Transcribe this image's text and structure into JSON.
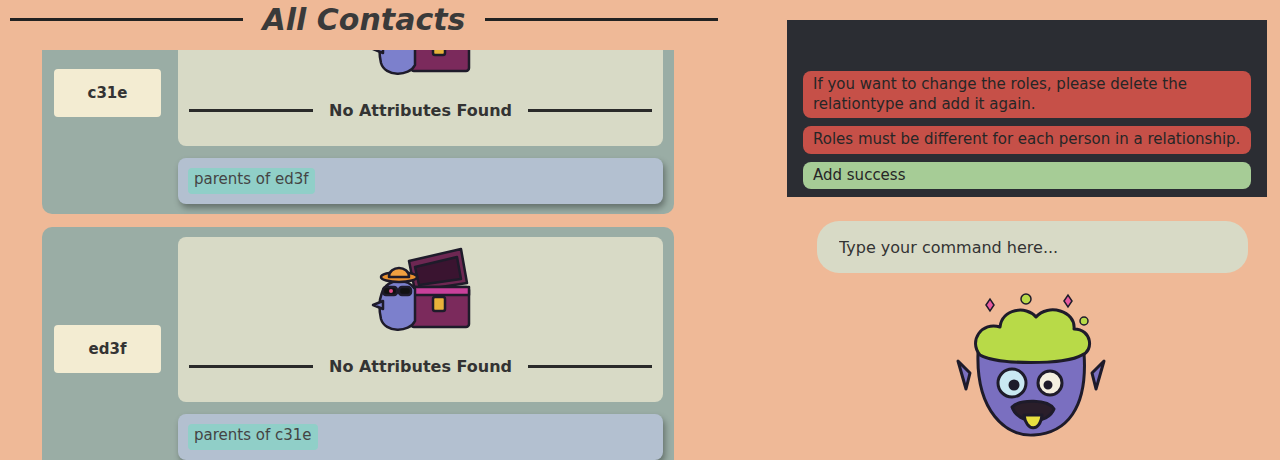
{
  "header": {
    "title": "All Contacts"
  },
  "contacts": [
    {
      "name": "c31e",
      "empty_label": "No Attributes Found",
      "relations": [
        "parents of ed3f"
      ]
    },
    {
      "name": "ed3f",
      "empty_label": "No Attributes Found",
      "relations": [
        "parents of c31e"
      ]
    }
  ],
  "messages": [
    {
      "text": "If you want to change the roles, please delete the\nrelationtype and add it again.",
      "kind": "error"
    },
    {
      "text": "Roles must be different for each person in a relationship.",
      "kind": "error"
    },
    {
      "text": "Add success",
      "kind": "success"
    }
  ],
  "command_input": {
    "placeholder": "Type your command here..."
  }
}
